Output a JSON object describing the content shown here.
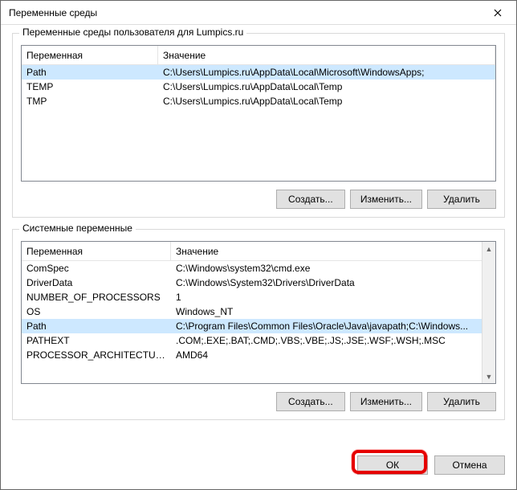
{
  "window": {
    "title": "Переменные среды"
  },
  "user_group": {
    "legend": "Переменные среды пользователя для Lumpics.ru",
    "columns": {
      "variable": "Переменная",
      "value": "Значение"
    },
    "rows": [
      {
        "name": "Path",
        "value": "C:\\Users\\Lumpics.ru\\AppData\\Local\\Microsoft\\WindowsApps;",
        "selected": true
      },
      {
        "name": "TEMP",
        "value": "C:\\Users\\Lumpics.ru\\AppData\\Local\\Temp",
        "selected": false
      },
      {
        "name": "TMP",
        "value": "C:\\Users\\Lumpics.ru\\AppData\\Local\\Temp",
        "selected": false
      }
    ],
    "buttons": {
      "create": "Создать...",
      "edit": "Изменить...",
      "delete": "Удалить"
    }
  },
  "system_group": {
    "legend": "Системные переменные",
    "columns": {
      "variable": "Переменная",
      "value": "Значение"
    },
    "rows": [
      {
        "name": "ComSpec",
        "value": "C:\\Windows\\system32\\cmd.exe",
        "selected": false
      },
      {
        "name": "DriverData",
        "value": "C:\\Windows\\System32\\Drivers\\DriverData",
        "selected": false
      },
      {
        "name": "NUMBER_OF_PROCESSORS",
        "value": "1",
        "selected": false
      },
      {
        "name": "OS",
        "value": "Windows_NT",
        "selected": false
      },
      {
        "name": "Path",
        "value": "C:\\Program Files\\Common Files\\Oracle\\Java\\javapath;C:\\Windows...",
        "selected": true
      },
      {
        "name": "PATHEXT",
        "value": ".COM;.EXE;.BAT;.CMD;.VBS;.VBE;.JS;.JSE;.WSF;.WSH;.MSC",
        "selected": false
      },
      {
        "name": "PROCESSOR_ARCHITECTURE",
        "value": "AMD64",
        "selected": false
      }
    ],
    "buttons": {
      "create": "Создать...",
      "edit": "Изменить...",
      "delete": "Удалить"
    }
  },
  "footer": {
    "ok": "ОК",
    "cancel": "Отмена"
  }
}
